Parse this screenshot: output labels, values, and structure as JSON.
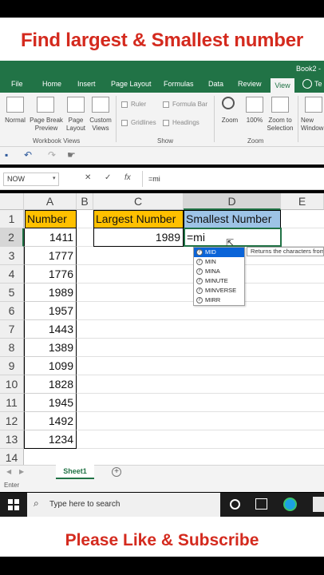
{
  "captions": {
    "top": "Find largest & Smallest number",
    "bottom": "Please Like & Subscribe"
  },
  "window": {
    "title": "Book2 -"
  },
  "ribbon": {
    "tabs": [
      "File",
      "Home",
      "Insert",
      "Page Layout",
      "Formulas",
      "Data",
      "Review",
      "View",
      "Te"
    ],
    "active_tab": "View",
    "workbook_views": {
      "label": "Workbook Views",
      "items": [
        "Normal",
        "Page Break Preview",
        "Page Layout",
        "Custom Views"
      ]
    },
    "show": {
      "label": "Show",
      "checkboxes": [
        "Ruler",
        "Formula Bar",
        "Gridlines",
        "Headings"
      ]
    },
    "zoom": {
      "label": "Zoom",
      "items": [
        "Zoom",
        "100%",
        "Zoom to Selection"
      ]
    },
    "window_group": {
      "items": [
        "New Window"
      ]
    }
  },
  "formula_bar": {
    "name_box": "NOW",
    "cancel": "✕",
    "enter": "✓",
    "fx": "fx",
    "formula": "=mi"
  },
  "grid": {
    "columns": [
      "A",
      "B",
      "C",
      "D",
      "E"
    ],
    "rows": [
      "1",
      "2",
      "3",
      "4",
      "5",
      "6",
      "7",
      "8",
      "9",
      "10",
      "11",
      "12",
      "13",
      "14"
    ],
    "col_a_header": "Number",
    "col_a_values": [
      "1411",
      "1777",
      "1776",
      "1989",
      "1957",
      "1443",
      "1389",
      "1099",
      "1828",
      "1945",
      "1492",
      "1234"
    ],
    "largest_label": "Largest Number",
    "largest_value": "1989",
    "smallest_label": "Smallest Number",
    "active_cell_text": "=mi"
  },
  "autocomplete": {
    "items": [
      "MID",
      "MIN",
      "MINA",
      "MINUTE",
      "MINVERSE",
      "MIRR"
    ],
    "selected": "MID",
    "tooltip": "Returns the characters from"
  },
  "sheets": {
    "tabs": [
      "Sheet1"
    ],
    "add": "+"
  },
  "status": {
    "text": "Enter"
  },
  "taskbar": {
    "search_placeholder": "Type here to search"
  },
  "colors": {
    "excel_green": "#217346",
    "header_yellow": "#ffc000",
    "header_blue": "#9dc3e6",
    "caption_red": "#d42a1e"
  }
}
